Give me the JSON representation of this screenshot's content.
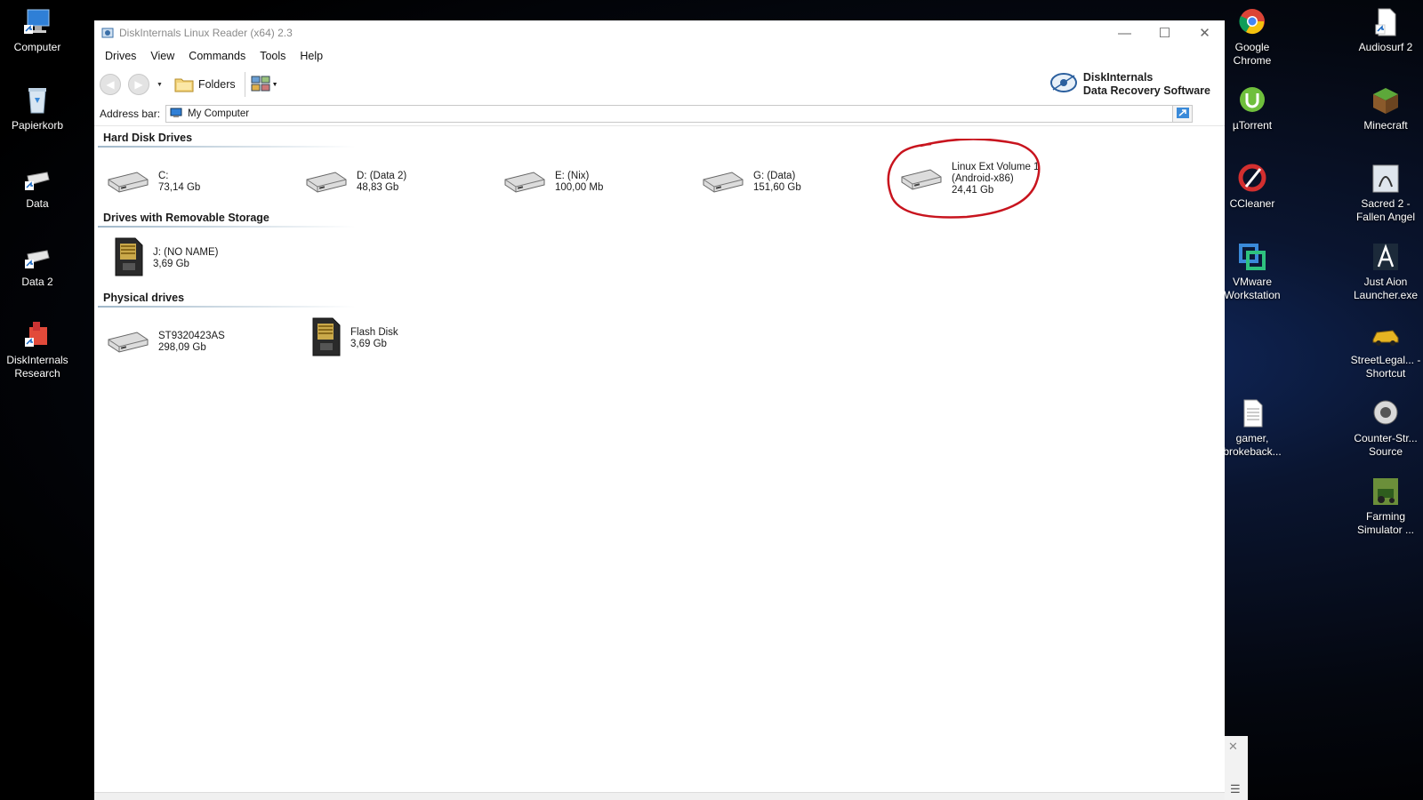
{
  "desktop": {
    "left_icons": [
      {
        "label": "Computer",
        "icon": "computer-icon"
      },
      {
        "label": "Papierkorb",
        "icon": "recycle-bin-icon"
      },
      {
        "label": "Data",
        "icon": "drive-shortcut-icon"
      },
      {
        "label": "Data 2",
        "icon": "drive-shortcut-icon"
      },
      {
        "label": "DiskInternals Research",
        "icon": "diskinternals-icon"
      }
    ],
    "right_col1": [
      {
        "label": "Google Chrome",
        "icon": "chrome-icon"
      },
      {
        "label": "µTorrent",
        "icon": "utorrent-icon"
      },
      {
        "label": "CCleaner",
        "icon": "ccleaner-icon"
      },
      {
        "label": "VMware Workstation",
        "icon": "vmware-icon"
      },
      {
        "label": "gamer, brokeback...",
        "icon": "text-file-icon"
      }
    ],
    "right_col2": [
      {
        "label": "Audiosurf 2",
        "icon": "file-shortcut-icon"
      },
      {
        "label": "Minecraft",
        "icon": "minecraft-icon"
      },
      {
        "label": "Sacred 2 - Fallen Angel",
        "icon": "sacred2-icon"
      },
      {
        "label": "Just Aion Launcher.exe",
        "icon": "aion-icon"
      },
      {
        "label": "StreetLegal... - Shortcut",
        "icon": "car-icon"
      },
      {
        "label": "Counter-Str... Source",
        "icon": "counter-strike-icon"
      },
      {
        "label": "Farming Simulator ...",
        "icon": "farming-icon"
      }
    ]
  },
  "window": {
    "title": "DiskInternals Linux Reader (x64) 2.3",
    "menu": [
      "Drives",
      "View",
      "Commands",
      "Tools",
      "Help"
    ],
    "toolbar": {
      "folders_label": "Folders"
    },
    "brand": {
      "line1": "DiskInternals",
      "line2": "Data Recovery Software"
    },
    "address": {
      "label": "Address bar:",
      "value": "My Computer"
    },
    "sections": [
      {
        "title": "Hard Disk Drives",
        "drives": [
          {
            "name": "C:",
            "size": "73,14 Gb",
            "type": "hdd"
          },
          {
            "name": "D: (Data 2)",
            "size": "48,83 Gb",
            "type": "hdd"
          },
          {
            "name": "E: (Nix)",
            "size": "100,00 Mb",
            "type": "hdd"
          },
          {
            "name": "G: (Data)",
            "size": "151,60 Gb",
            "type": "hdd"
          },
          {
            "name": "Linux Ext Volume 1",
            "sub": "(Android-x86)",
            "size": "24,41 Gb",
            "type": "hdd",
            "highlighted": true
          }
        ]
      },
      {
        "title": "Drives with Removable Storage",
        "drives": [
          {
            "name": "J: (NO NAME)",
            "size": "3,69 Gb",
            "type": "sd"
          }
        ]
      },
      {
        "title": "Physical drives",
        "drives": [
          {
            "name": "ST9320423AS",
            "size": "298,09 Gb",
            "type": "hdd"
          },
          {
            "name": "Flash Disk",
            "size": "3,69 Gb",
            "type": "sd"
          }
        ]
      }
    ]
  },
  "colors": {
    "highlight_circle": "#c8141e",
    "accent": "#2b6cb0"
  }
}
